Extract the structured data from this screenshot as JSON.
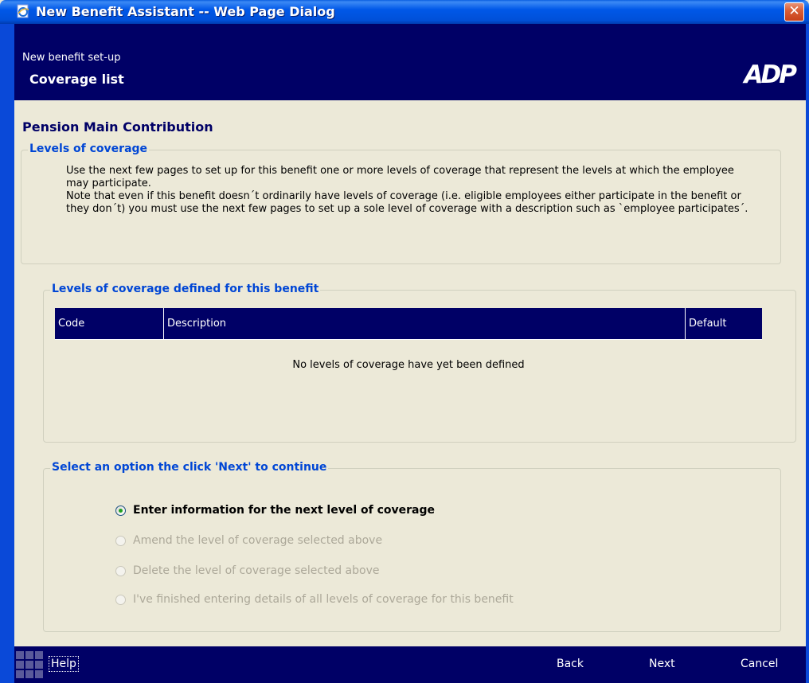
{
  "window": {
    "title": "New Benefit Assistant -- Web Page Dialog",
    "close_glyph": "✕",
    "title_icon": "ie-page-icon",
    "close_icon": "close-icon"
  },
  "header": {
    "subtitle": "New benefit set-up",
    "title": "Coverage list",
    "logo_text": "ADP"
  },
  "page": {
    "heading": "Pension Main Contribution"
  },
  "levels_info": {
    "legend": "Levels of coverage",
    "paragraph1": "Use the next few pages to set up for this benefit one or more levels of coverage that represent the levels at which the employee may participate.",
    "paragraph2": "Note that even if this benefit doesn´t ordinarily have levels of coverage (i.e. eligible employees either participate in the benefit or they don´t) you must use the next few pages to set up a sole level of coverage with a description such as `employee participates´."
  },
  "levels_table": {
    "legend": "Levels of coverage defined for this benefit",
    "columns": [
      "Code",
      "Description",
      "Default"
    ],
    "rows": [],
    "empty_message": "No levels of coverage have yet been defined"
  },
  "options": {
    "legend": "Select an option the click 'Next' to continue",
    "items": [
      {
        "label": "Enter information for the next level of coverage",
        "selected": true,
        "enabled": true
      },
      {
        "label": "Amend the level of coverage selected above",
        "selected": false,
        "enabled": false
      },
      {
        "label": "Delete the level of coverage selected above",
        "selected": false,
        "enabled": false
      },
      {
        "label": "I've finished entering details of all levels of coverage for this benefit",
        "selected": false,
        "enabled": false
      }
    ]
  },
  "footer": {
    "help_label": "Help",
    "back_label": "Back",
    "next_label": "Next",
    "cancel_label": "Cancel"
  },
  "colors": {
    "navy": "#000066",
    "legend_blue": "#0046D5",
    "xp_title_blue": "#0058E8",
    "background": "#ECE9D8"
  }
}
